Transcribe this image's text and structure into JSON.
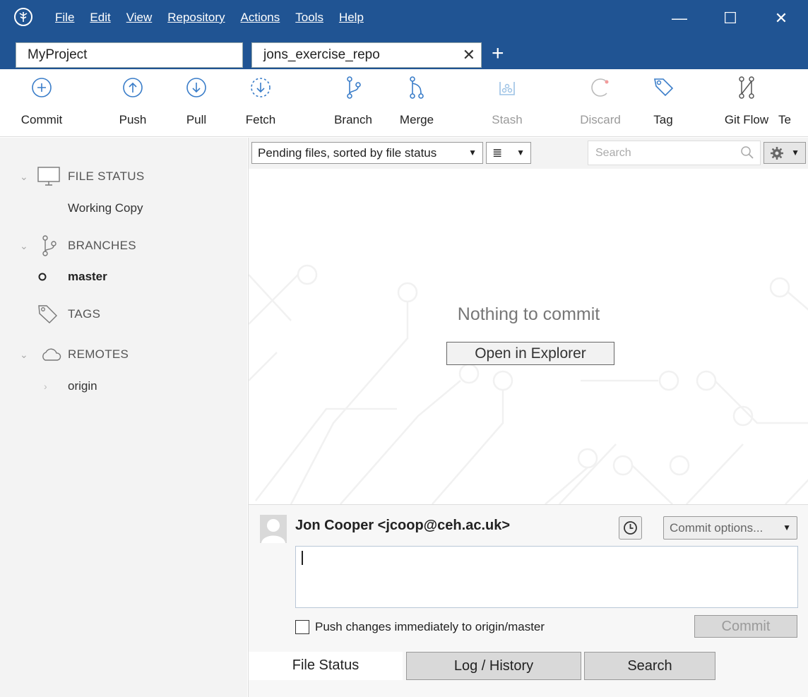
{
  "window": {
    "menu": [
      "File",
      "Edit",
      "View",
      "Repository",
      "Actions",
      "Tools",
      "Help"
    ],
    "controls": {
      "minimize": "—",
      "maximize": "☐",
      "close": "✕"
    }
  },
  "tabs": {
    "items": [
      "MyProject",
      "jons_exercise_repo"
    ],
    "close_glyph": "✕",
    "add_glyph": "+"
  },
  "toolbar": {
    "items": [
      {
        "label": "Commit",
        "icon": "commit-icon"
      },
      {
        "label": "Push",
        "icon": "push-icon"
      },
      {
        "label": "Pull",
        "icon": "pull-icon"
      },
      {
        "label": "Fetch",
        "icon": "fetch-icon"
      },
      {
        "label": "Branch",
        "icon": "branch-icon"
      },
      {
        "label": "Merge",
        "icon": "merge-icon"
      },
      {
        "label": "Stash",
        "icon": "stash-icon",
        "disabled": true
      },
      {
        "label": "Discard",
        "icon": "discard-icon",
        "disabled": true
      },
      {
        "label": "Tag",
        "icon": "tag-icon"
      },
      {
        "label": "Git Flow",
        "icon": "git-flow-icon"
      },
      {
        "label": "Te",
        "icon": "terminal-icon"
      }
    ]
  },
  "sidebar": {
    "file_status": {
      "title": "FILE STATUS",
      "items": [
        "Working Copy"
      ]
    },
    "branches": {
      "title": "BRANCHES",
      "items": [
        "master"
      ]
    },
    "tags": {
      "title": "TAGS"
    },
    "remotes": {
      "title": "REMOTES",
      "items": [
        "origin"
      ]
    }
  },
  "main": {
    "sort_select": "Pending files, sorted by file status",
    "view_select": "≣",
    "search_placeholder": "Search",
    "empty_message": "Nothing to commit",
    "open_explorer": "Open in Explorer"
  },
  "commit": {
    "author": "Jon Cooper <jcoop@ceh.ac.uk>",
    "options_label": "Commit options...",
    "message": "",
    "push_label": "Push changes immediately to origin/master",
    "push_checked": false,
    "commit_button": "Commit"
  },
  "bottom_tabs": [
    "File Status",
    "Log / History",
    "Search"
  ],
  "colors": {
    "titlebar": "#205493",
    "sidebar": "#f3f3f3",
    "accent_icon": "#3a7dc9"
  }
}
